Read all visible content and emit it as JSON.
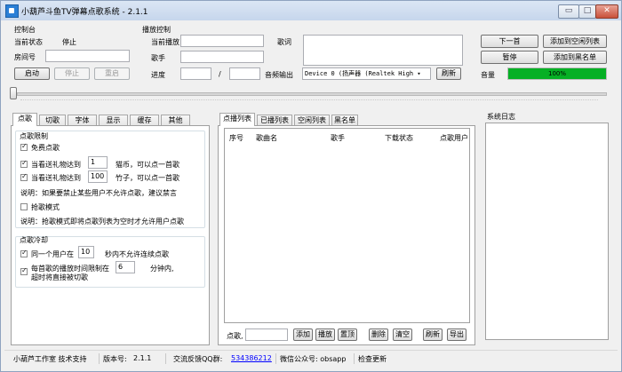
{
  "window": {
    "title": "小葫芦斗鱼TV弹幕点歌系统 - 2.1.1"
  },
  "console": {
    "header": "控制台",
    "status_label": "当前状态",
    "status_value": "停止",
    "room_label": "房间号",
    "room_value": "",
    "start": "启动",
    "stop": "停止",
    "restart": "重启"
  },
  "playback": {
    "header": "播放控制",
    "now_playing_label": "当前播放",
    "lyrics_label": "歌词",
    "singer_label": "歌手",
    "progress_label": "进度",
    "progress_sep": "/",
    "audio_output_label": "音频输出",
    "audio_device": "Device 0 (扬声器 (Realtek High ▾",
    "refresh": "刷新",
    "volume_label": "音量",
    "volume_text": "100%",
    "volume_level": 1.0,
    "next": "下一首",
    "add_to_idle": "添加到空闲列表",
    "pause": "暂停",
    "add_to_blacklist": "添加到黑名单"
  },
  "left_tabs": [
    "点歌",
    "切歌",
    "字体",
    "显示",
    "缓存",
    "其他"
  ],
  "request_limit": {
    "header": "点歌限制",
    "free_label": "免费点歌",
    "free_checked": true,
    "gift1_prefix": "当看送礼物达到",
    "gift1_value": "1",
    "gift1_suffix": "猫币，可以点一首歌",
    "gift1_checked": true,
    "gift2_prefix": "当看送礼物达到",
    "gift2_value": "100",
    "gift2_suffix": "竹子，可以点一首歌",
    "gift2_checked": true,
    "note1": "说明：如果要禁止某些用户不允许点歌，建议禁言",
    "grab_label": "抢歌模式",
    "grab_checked": false,
    "note2": "说明：抢歌模式即将点歌列表为空时才允许用户点歌"
  },
  "cooldown": {
    "header": "点歌冷却",
    "same_user_prefix": "同一个用户在",
    "same_user_value": "10",
    "same_user_suffix": "秒内不允许连续点歌",
    "same_user_checked": true,
    "max_time_line1": "每首歌的播放时间限制在",
    "max_time_value": "6",
    "max_time_unit": "分钟内,",
    "max_time_line2": "超时将直接被切歌",
    "max_time_checked": true
  },
  "list_tabs": [
    "点播列表",
    "已播列表",
    "空闲列表",
    "黑名单"
  ],
  "table_headers": [
    "序号",
    "歌曲名",
    "歌手",
    "下载状态",
    "点歌用户"
  ],
  "list_bottom": {
    "label": "点歌,",
    "input_value": "",
    "buttons": [
      "添加",
      "播放",
      "置顶",
      "删除",
      "清空",
      "刷新",
      "导出"
    ]
  },
  "syslog": {
    "header": "系统日志"
  },
  "status_bar": {
    "credit": "小葫芦工作室 技术支持",
    "version_label": "版本号:",
    "version": "2.1.1",
    "qq_label": "交流反馈QQ群:",
    "qq_group": "534386212",
    "wechat": "微信公众号: obsapp",
    "check_update": "检查更新"
  },
  "colors": {
    "volume_fill": "#06b025",
    "link": "#0000ff"
  }
}
